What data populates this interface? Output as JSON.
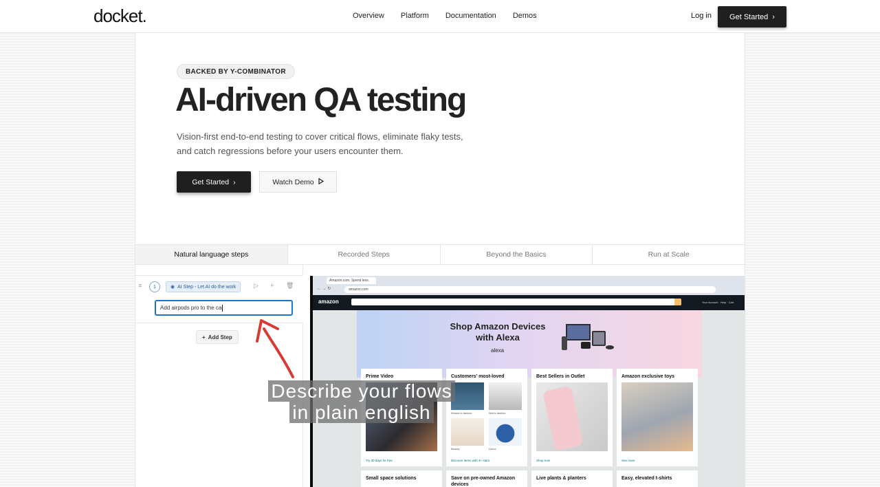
{
  "header": {
    "logo": "docket.",
    "nav": [
      "Overview",
      "Platform",
      "Documentation",
      "Demos"
    ],
    "login": "Log in",
    "cta": "Get Started"
  },
  "hero": {
    "badge": "BACKED BY Y-COMBINATOR",
    "title": "AI-driven QA testing",
    "subtitle": "Vision-first end-to-end testing to cover critical flows, eliminate flaky tests, and catch regressions before your users encounter them.",
    "primary_button": "Get Started",
    "secondary_button": "Watch Demo"
  },
  "tabs": [
    "Natural language steps",
    "Recorded Steps",
    "Beyond the Basics",
    "Run at Scale"
  ],
  "step_editor": {
    "step_number": "1",
    "step_type": "AI Step - Let AI do the work",
    "input_value": "Add airpods pro to the ca",
    "add_step": "Add Step"
  },
  "browser": {
    "tab_title": "Amazon.com. Spend less.",
    "url": "amazon.com",
    "logo": "amazon",
    "nav_text": "Your Account · Help · Cart",
    "search_go": "Go",
    "banner_title": "Shop Amazon Devices with Alexa",
    "banner_sub": "alexa",
    "cards": [
      {
        "title": "Prime Video",
        "link": "Try 30 days for free"
      },
      {
        "title": "Customers' most-loved",
        "link": "Discover items with 4+ stars",
        "sub_labels": [
          "Women's fashion",
          "Men's fashion",
          "Beauty",
          "Home"
        ]
      },
      {
        "title": "Best Sellers in Outlet",
        "link": "Shop now"
      },
      {
        "title": "Amazon exclusive toys",
        "link": "See more"
      }
    ],
    "cards_row2": [
      "Small space solutions",
      "Save on pre-owned Amazon devices",
      "Live plants & planters",
      "Easy, elevated t-shirts"
    ]
  },
  "caption": [
    "Describe your flows",
    "in plain english"
  ],
  "colors": {
    "dark_button": "#1f1f1f",
    "accent_blue": "#1a73c8",
    "amazon_nav": "#131921",
    "arrow_red": "#d63b34"
  }
}
